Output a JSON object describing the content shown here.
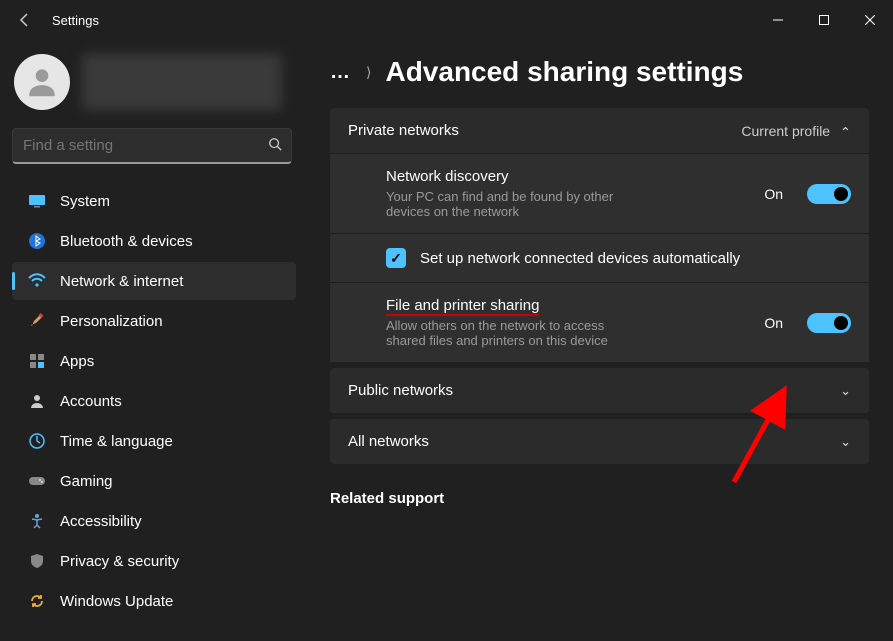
{
  "window": {
    "title": "Settings"
  },
  "search": {
    "placeholder": "Find a setting"
  },
  "nav": {
    "items": [
      {
        "label": "System"
      },
      {
        "label": "Bluetooth & devices"
      },
      {
        "label": "Network & internet"
      },
      {
        "label": "Personalization"
      },
      {
        "label": "Apps"
      },
      {
        "label": "Accounts"
      },
      {
        "label": "Time & language"
      },
      {
        "label": "Gaming"
      },
      {
        "label": "Accessibility"
      },
      {
        "label": "Privacy & security"
      },
      {
        "label": "Windows Update"
      }
    ],
    "active_index": 2
  },
  "breadcrumb": {
    "title": "Advanced sharing settings"
  },
  "private_networks": {
    "title": "Private networks",
    "badge": "Current profile",
    "discovery": {
      "title": "Network discovery",
      "desc": "Your PC can find and be found by other devices on the network",
      "state_label": "On",
      "state": true
    },
    "auto_setup": {
      "label": "Set up network connected devices automatically",
      "checked": true
    },
    "file_printer": {
      "title": "File and printer sharing",
      "desc": "Allow others on the network to access shared files and printers on this device",
      "state_label": "On",
      "state": true
    }
  },
  "public_networks": {
    "title": "Public networks"
  },
  "all_networks": {
    "title": "All networks"
  },
  "related_support": {
    "title": "Related support"
  },
  "colors": {
    "accent": "#4cc2ff",
    "annotation": "#ff0000"
  }
}
